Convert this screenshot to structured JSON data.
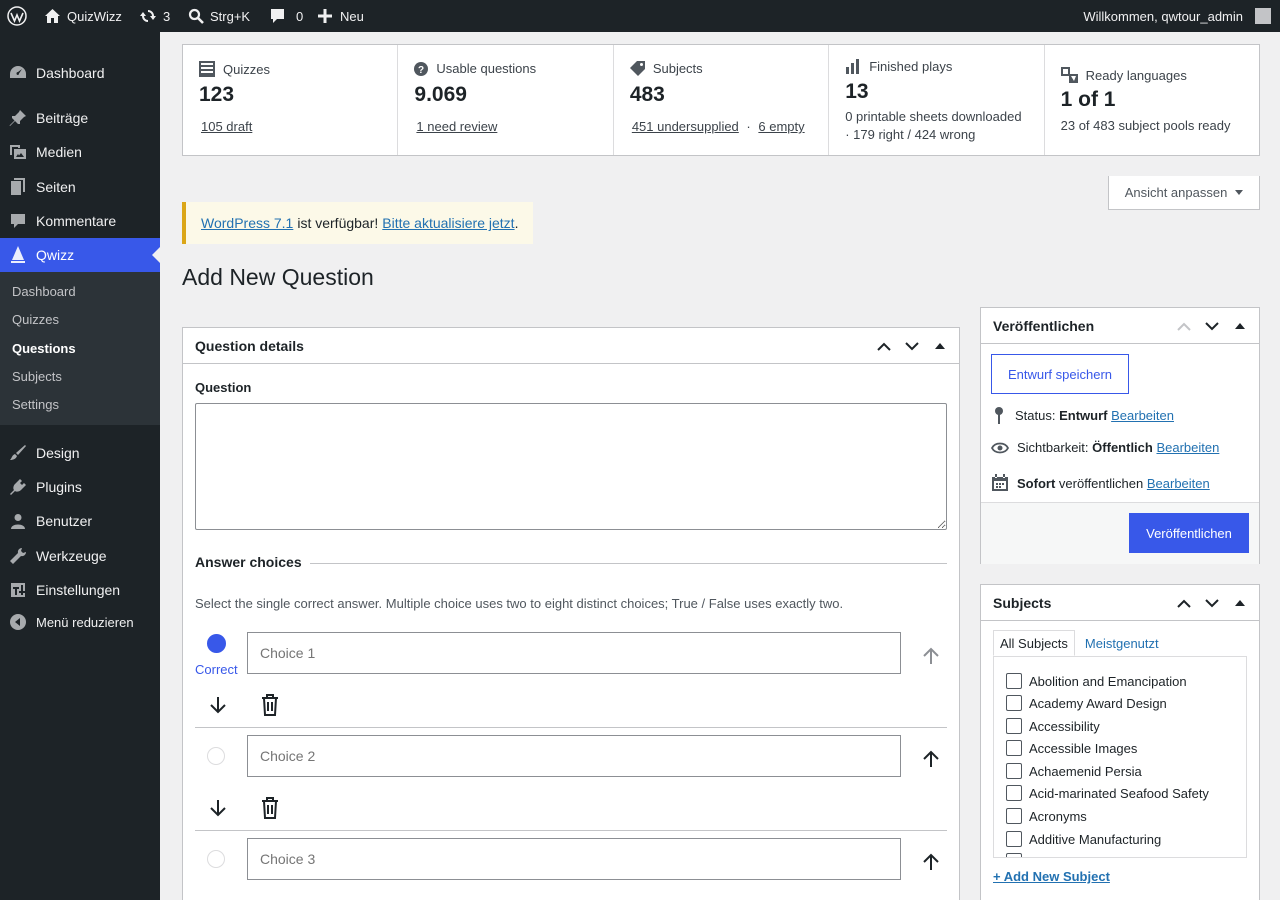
{
  "adminbar": {
    "site_name": "QuizWizz",
    "updates_count": "3",
    "search_shortcut": "Strg+K",
    "comments_count": "0",
    "new_label": "Neu",
    "greeting": "Willkommen, qwtour_admin"
  },
  "menu": {
    "items": [
      {
        "label": "Dashboard",
        "icon": "dashboard-icon"
      },
      {
        "label": "Beiträge",
        "icon": "pin-icon"
      },
      {
        "label": "Medien",
        "icon": "media-icon"
      },
      {
        "label": "Seiten",
        "icon": "pages-icon"
      },
      {
        "label": "Kommentare",
        "icon": "comments-icon"
      },
      {
        "label": "Qwizz",
        "icon": "qwizz-icon"
      },
      {
        "label": "Design",
        "icon": "brush-icon"
      },
      {
        "label": "Plugins",
        "icon": "plugin-icon"
      },
      {
        "label": "Benutzer",
        "icon": "users-icon"
      },
      {
        "label": "Werkzeuge",
        "icon": "tools-icon"
      },
      {
        "label": "Einstellungen",
        "icon": "settings-icon"
      },
      {
        "label": "Menü reduzieren",
        "icon": "collapse-icon"
      }
    ],
    "submenu": [
      "Dashboard",
      "Quizzes",
      "Questions",
      "Subjects",
      "Settings"
    ]
  },
  "stats": {
    "quizzes": {
      "label": "Quizzes",
      "value": "123",
      "link": "105 draft"
    },
    "usable": {
      "label": "Usable questions",
      "value": "9.069",
      "link": "1 need review"
    },
    "subjects": {
      "label": "Subjects",
      "value": "483",
      "link1": "451 undersupplied",
      "sep": "·",
      "link2": "6 empty"
    },
    "plays": {
      "label": "Finished plays",
      "value": "13",
      "line1": "0 printable sheets downloaded",
      "line2": "· 179 right / 424 wrong"
    },
    "languages": {
      "label": "Ready languages",
      "value": "1 of 1",
      "desc": "23 of 483 subject pools ready"
    }
  },
  "screen_options": "Ansicht anpassen",
  "notice": {
    "link1": "WordPress 7.1",
    "text": "ist verfügbar!",
    "link2": "Bitte aktualisiere jetzt",
    "end": "."
  },
  "page_title": "Add New Question",
  "question_box": {
    "title": "Question details",
    "question_label": "Question",
    "answers_title": "Answer choices",
    "hint": "Select the single correct answer. Multiple choice uses two to eight distinct choices; True / False uses exactly two.",
    "correct_label": "Correct",
    "choices": [
      {
        "placeholder": "Choice 1",
        "correct": true
      },
      {
        "placeholder": "Choice 2",
        "correct": false
      },
      {
        "placeholder": "Choice 3",
        "correct": false
      }
    ]
  },
  "publish": {
    "title": "Veröffentlichen",
    "save_draft": "Entwurf speichern",
    "status_label": "Status:",
    "status_value": "Entwurf",
    "visibility_label": "Sichtbarkeit:",
    "visibility_value": "Öffentlich",
    "schedule_value": "Sofort",
    "schedule_text": "veröffentlichen",
    "edit": "Bearbeiten",
    "publish_button": "Veröffentlichen"
  },
  "subjects_box": {
    "title": "Subjects",
    "tab_all": "All Subjects",
    "tab_popular": "Meistgenutzt",
    "items": [
      "Abolition and Emancipation",
      "Academy Award Design",
      "Accessibility",
      "Accessible Images",
      "Achaemenid Persia",
      "Acid-marinated Seafood Safety",
      "Acronyms",
      "Additive Manufacturing"
    ],
    "add_new": "+ Add New Subject"
  }
}
